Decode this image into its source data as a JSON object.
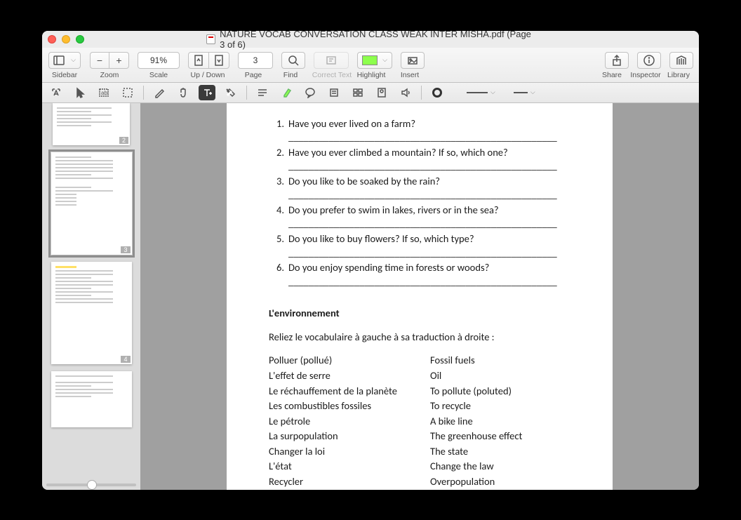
{
  "window": {
    "title": "NATURE VOCAB CONVERSATION CLASS WEAK INTER MISHA.pdf (Page 3 of 6)"
  },
  "toolbar": {
    "zoom_pct": "91%",
    "page_num": "3",
    "labels": {
      "sidebar": "Sidebar",
      "zoom": "Zoom",
      "scale": "Scale",
      "updown": "Up / Down",
      "page": "Page",
      "find": "Find",
      "correct": "Correct Text",
      "highlight": "Highlight",
      "insert": "Insert",
      "share": "Share",
      "inspector": "Inspector",
      "library": "Library"
    }
  },
  "thumbs": {
    "p2": "2",
    "p3": "3",
    "p4": "4"
  },
  "doc": {
    "questions": [
      {
        "n": "1.",
        "t": "Have you ever lived on a farm?"
      },
      {
        "n": "2.",
        "t": "Have you ever climbed a mountain? If so, which one?"
      },
      {
        "n": "3.",
        "t": "Do you like to be soaked by the rain?"
      },
      {
        "n": "4.",
        "t": "Do you prefer to swim in lakes, rivers or in the sea?"
      },
      {
        "n": "5.",
        "t": "Do you like to buy flowers? If so, which type?"
      },
      {
        "n": "6.",
        "t": "Do you enjoy spending time in forests or woods?"
      }
    ],
    "blank": "_____________________________________________________",
    "section_title": "L'environnement",
    "instr": "Reliez le vocabulaire à gauche à sa traduction à droite :",
    "left": [
      "Polluer (pollué)",
      "L'effet de serre",
      "Le réchauffement de la planète",
      "Les combustibles fossiles",
      "Le pétrole",
      "La surpopulation",
      "Changer la loi",
      "L'état",
      "Recycler"
    ],
    "right": [
      "Fossil fuels",
      "Oil",
      "To pollute (poluted)",
      "To recycle",
      "A bike line",
      "The greenhouse effect",
      "The state",
      "Change the law",
      "Overpopulation"
    ]
  }
}
